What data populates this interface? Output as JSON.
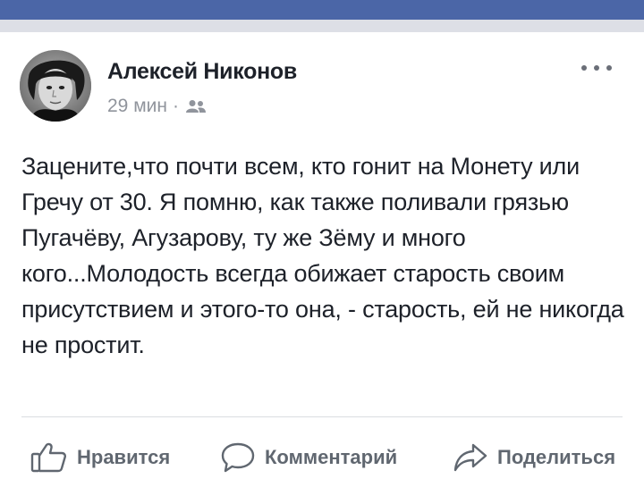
{
  "colors": {
    "topbar": "#4b66a7",
    "text_primary": "#1d2129",
    "text_secondary": "#90949c",
    "action_text": "#606770"
  },
  "post": {
    "author": "Алексей Никонов",
    "time": "29 мин",
    "separator": "·",
    "audience_icon": "friends-icon",
    "text": "Зацените,что почти всем, кто гонит на Монету или Гречу от 30. Я помню, как также поливали грязью Пугачёву, Агузарову, ту же Зёму и много кого...Молодость всегда обижает старость своим присутствием и этого-то она, - старость, ей не никогда не простит."
  },
  "actions": {
    "like": {
      "label": "Нравится",
      "icon": "thumbs-up-icon"
    },
    "comment": {
      "label": "Комментарий",
      "icon": "comment-bubble-icon"
    },
    "share": {
      "label": "Поделиться",
      "icon": "share-arrow-icon"
    }
  }
}
